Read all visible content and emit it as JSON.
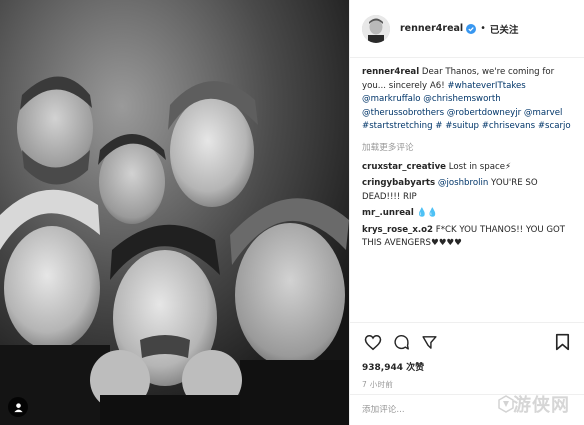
{
  "post": {
    "username": "renner4real",
    "follow_state": "已关注",
    "separator": "•",
    "caption_user": "renner4real",
    "caption_text": "Dear Thanos, we're coming for you... sincerely A6!",
    "caption_tags": [
      "#whateverITtakes",
      "@markruffalo",
      "@chrishemsworth",
      "@therussobrothers",
      "@robertdowneyjr",
      "@marvel",
      "#startstretching",
      "#",
      "#suitup",
      "#chrisevans",
      "#scarjo"
    ],
    "load_more": "加载更多评论",
    "likes": "938,944 次赞",
    "time": "7 小时前",
    "add_comment_placeholder": "添加评论..."
  },
  "comments": [
    {
      "user": "cruxstar_creative",
      "text": "Lost in space⚡"
    },
    {
      "user": "cringybabyarts",
      "mention": "@joshbrolin",
      "text": "YOU'RE SO DEAD!!!! RIP"
    },
    {
      "user": "mr_.unreal",
      "text": "💧💧"
    },
    {
      "user": "krys_rose_x.o2",
      "text": "F*CK YOU THANOS!! YOU GOT THIS AVENGERS♥♥♥♥"
    }
  ],
  "watermark": "游侠网",
  "icons": [
    "heart-icon",
    "comment-icon",
    "share-icon",
    "bookmark-icon",
    "tag-people-icon",
    "verified-icon"
  ],
  "colors": {
    "link": "#003569",
    "muted": "#999999",
    "text": "#262626",
    "verified": "#3897f0"
  }
}
